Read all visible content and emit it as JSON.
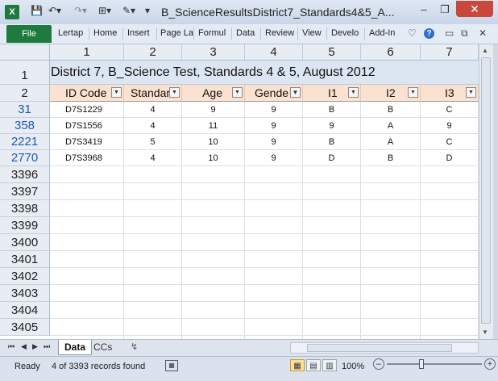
{
  "window": {
    "title": "B_ScienceResultsDistrict7_Standards4&5_A...",
    "minimize": "–",
    "restore": "❐",
    "close": "✕"
  },
  "quick_access": {
    "app_icon": "X",
    "save": "💾",
    "undo": "↶▾",
    "redo": "↷▾",
    "layout": "⊞▾",
    "format": "✎▾",
    "more": "▾"
  },
  "ribbon": {
    "file_tab": "File",
    "tabs": [
      "Lertap",
      "Home",
      "Insert",
      "Page La",
      "Formul",
      "Data",
      "Review",
      "View",
      "Develo",
      "Add-In"
    ],
    "icons": {
      "heart": "♡",
      "help": "?",
      "min": "▭",
      "restore": "⧉",
      "close": "✕"
    }
  },
  "columns": [
    "1",
    "2",
    "3",
    "4",
    "5",
    "6",
    "7"
  ],
  "row_headers": [
    "1",
    "2",
    "31",
    "358",
    "2221",
    "2770",
    "3396",
    "3397",
    "3398",
    "3399",
    "3400",
    "3401",
    "3402",
    "3403",
    "3404",
    "3405"
  ],
  "sheet": {
    "title": "District 7, B_Science Test, Standards 4 & 5, August 2012",
    "headers": [
      "ID Code",
      "Standar",
      "Age",
      "Gende",
      "I1",
      "I2",
      "I3"
    ],
    "rows": [
      [
        "D7S1229",
        "4",
        "9",
        "9",
        "B",
        "B",
        "C"
      ],
      [
        "D7S1556",
        "4",
        "11",
        "9",
        "9",
        "A",
        "9"
      ],
      [
        "D7S3419",
        "5",
        "10",
        "9",
        "B",
        "A",
        "C"
      ],
      [
        "D7S3968",
        "4",
        "10",
        "9",
        "D",
        "B",
        "D"
      ]
    ]
  },
  "sheet_tabs": {
    "nav": [
      "⏮",
      "◀",
      "▶",
      "⏭"
    ],
    "data": "Data",
    "ccs": "CCs",
    "new": "↯"
  },
  "status": {
    "ready": "Ready",
    "records": "4 of 3393 records found",
    "zoom": "100%",
    "minus": "–",
    "plus": "+"
  }
}
